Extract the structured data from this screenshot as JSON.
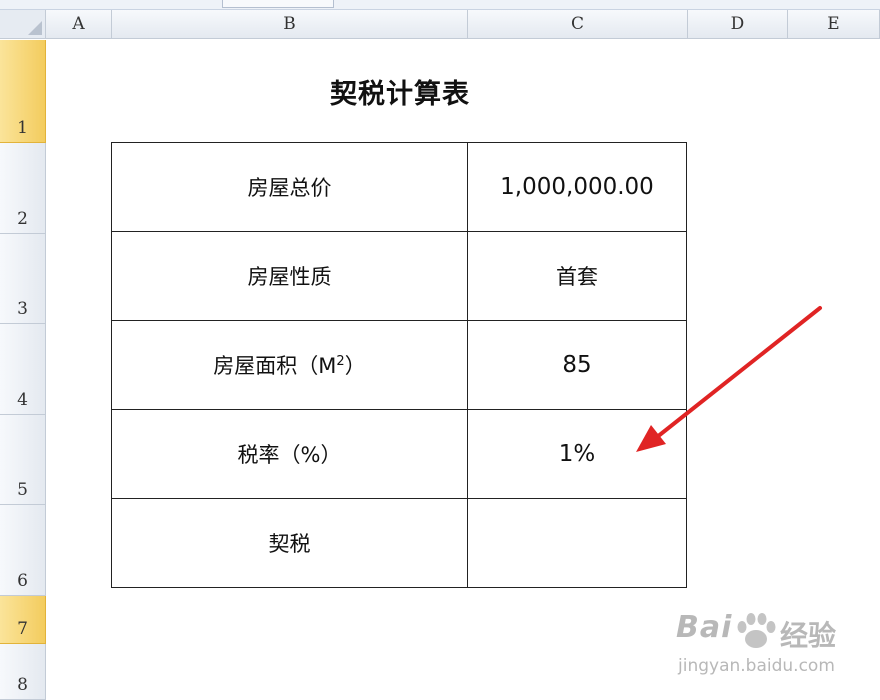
{
  "columns": [
    "A",
    "B",
    "C",
    "D",
    "E"
  ],
  "rows": [
    "1",
    "2",
    "3",
    "4",
    "5",
    "6",
    "7",
    "8"
  ],
  "sheet": {
    "title": "契税计算表",
    "r2": {
      "label": "房屋总价",
      "value": "1,000,000.00"
    },
    "r3": {
      "label": "房屋性质",
      "value": "首套"
    },
    "r4": {
      "label": "房屋面积（M",
      "label_sup": "2",
      "label_end": "）",
      "value": "85"
    },
    "r5": {
      "label": "税率（%）",
      "value": "1%"
    },
    "r6": {
      "label": "契税",
      "value": ""
    }
  },
  "watermark": {
    "brand": "Bai",
    "brand_cn": "经验",
    "url": "jingyan.baidu.com"
  },
  "colors": {
    "arrow": "#e02424",
    "row_selected": "#f3cc5e"
  }
}
